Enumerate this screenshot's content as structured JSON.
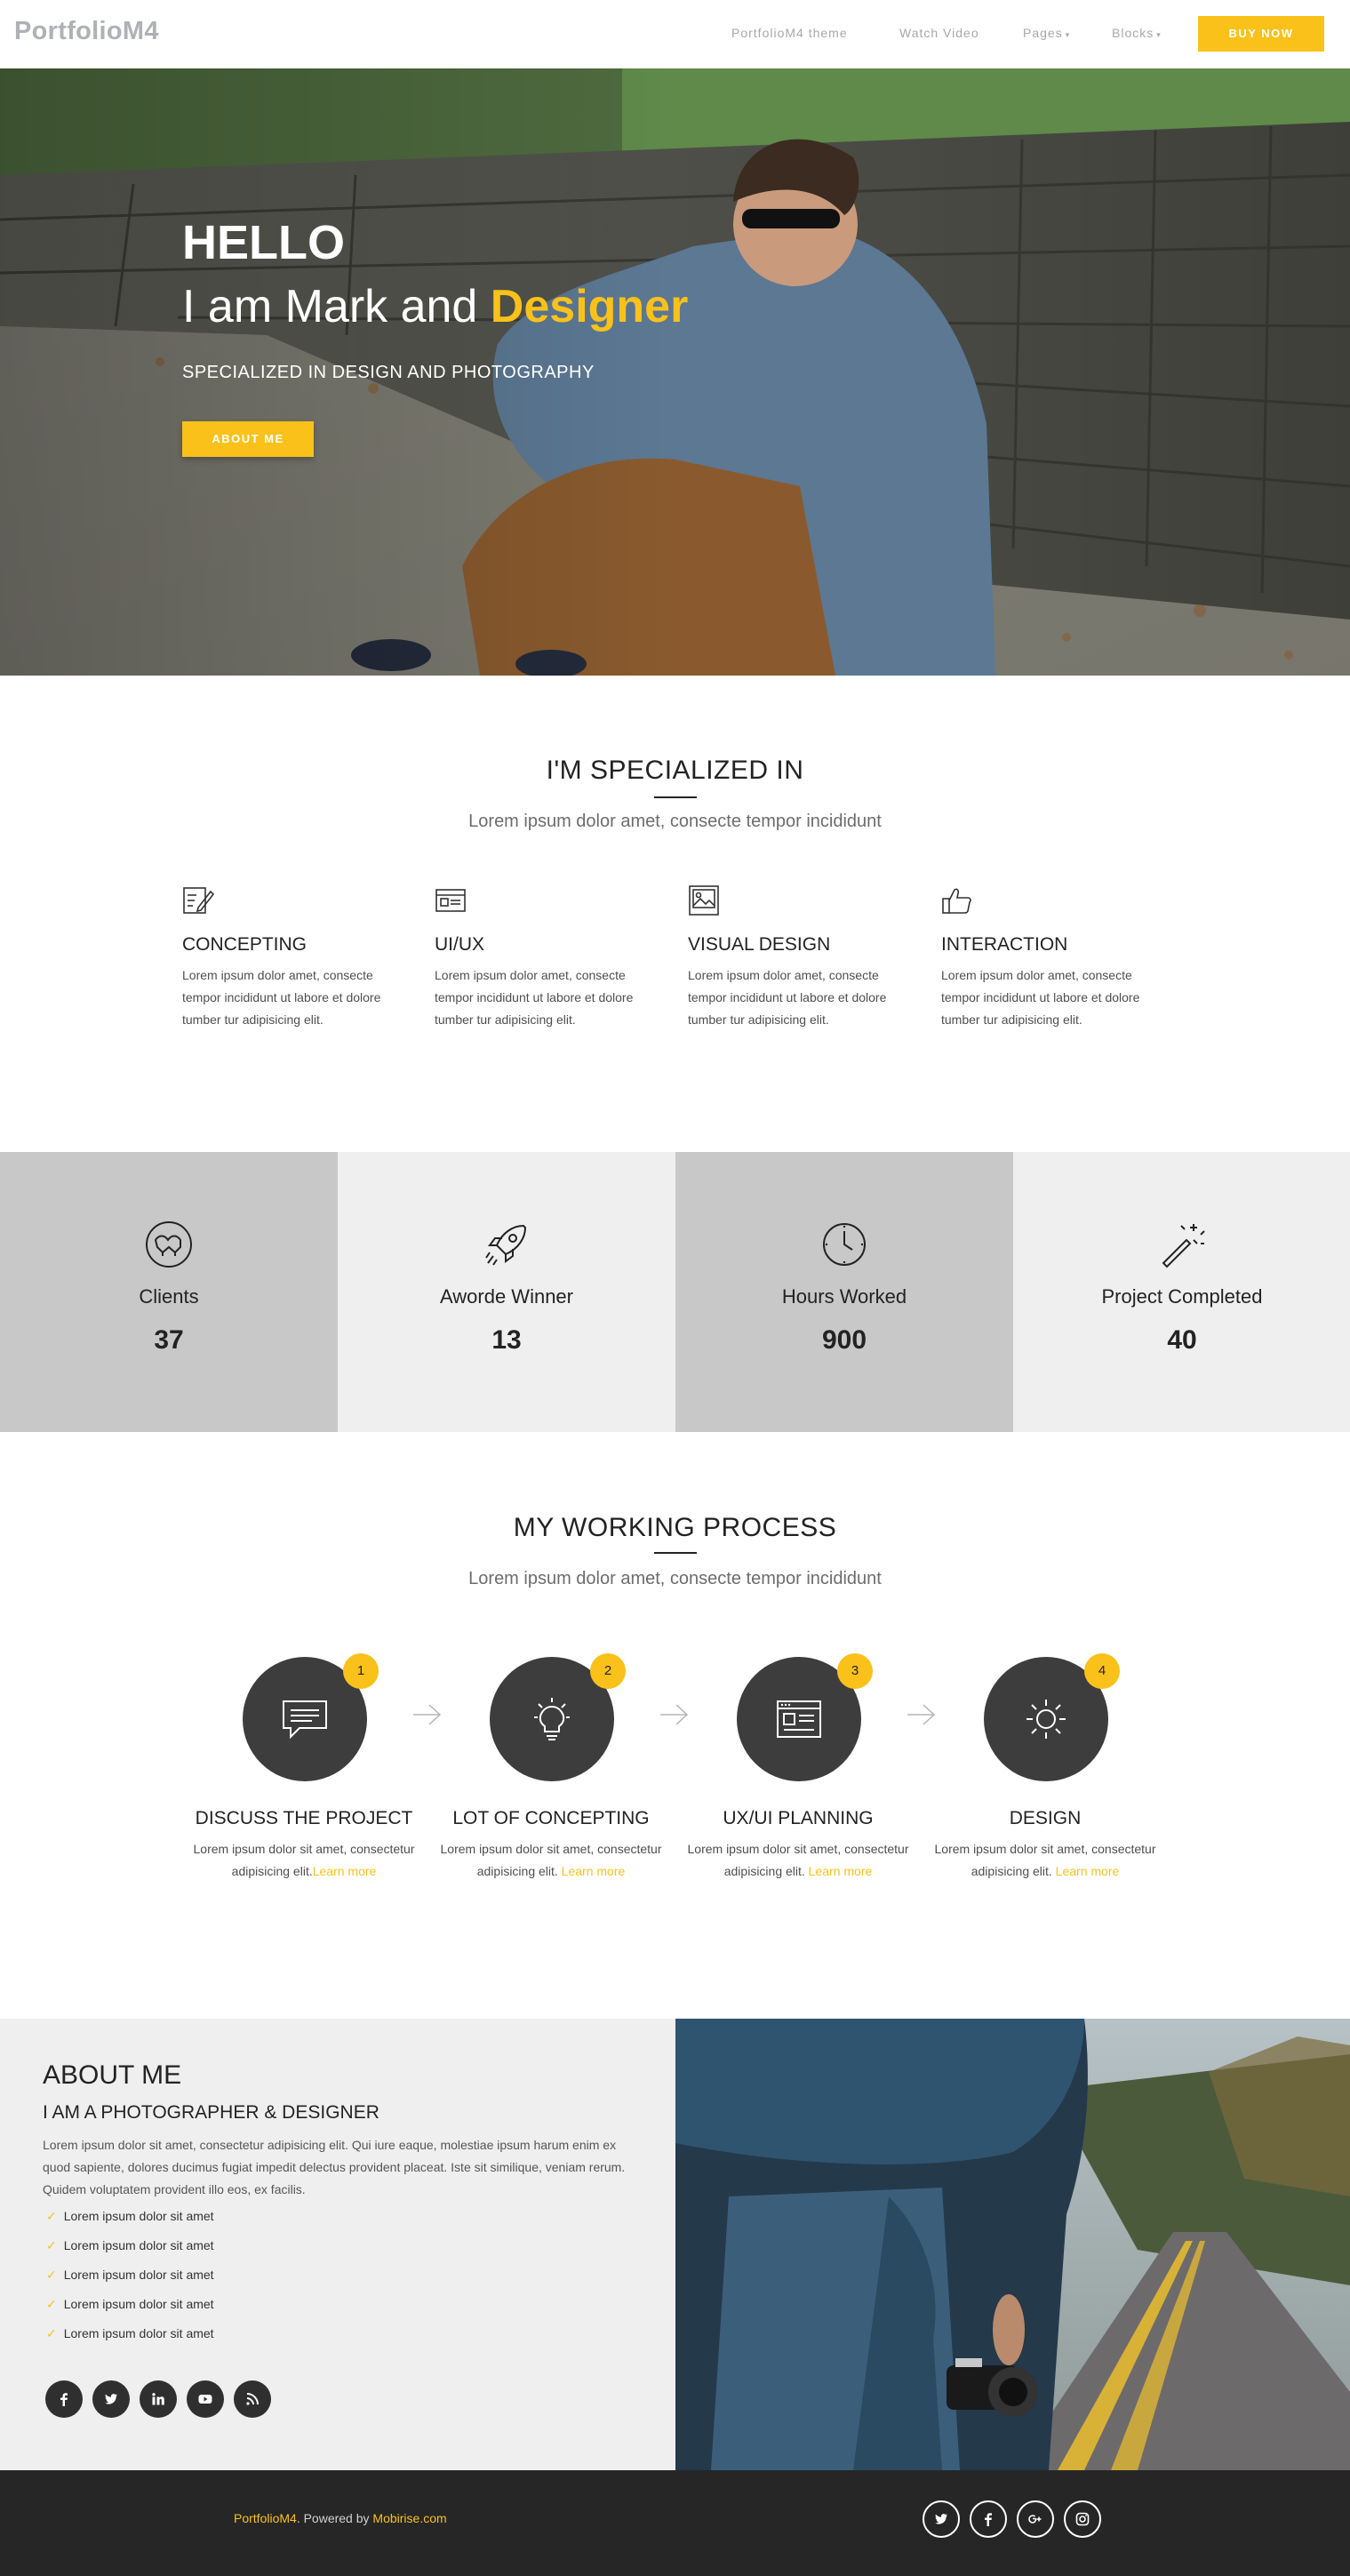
{
  "navbar": {
    "brand": "PortfolioM4",
    "links": [
      "PortfolioM4 theme",
      "Watch Video",
      "Pages",
      "Blocks"
    ],
    "buy_button": "BUY NOW"
  },
  "hero": {
    "hello": "HELLO",
    "iam_prefix": "I am Mark and ",
    "iam_accent": "Designer",
    "subtitle": "SPECIALIZED IN DESIGN AND PHOTOGRAPHY",
    "button": "ABOUT ME"
  },
  "specialized": {
    "title": "I'M SPECIALIZED IN",
    "subtitle": "Lorem ipsum dolor amet, consecte tempor incididunt",
    "items": [
      {
        "title": "CONCEPTING",
        "icon": "edit-note-icon",
        "text": "Lorem ipsum dolor amet, consecte tempor incididunt ut labore et dolore tumber tur adipisicing elit."
      },
      {
        "title": "UI/UX",
        "icon": "browser-window-icon",
        "text": "Lorem ipsum dolor amet, consecte tempor incididunt ut labore et dolore tumber tur adipisicing elit."
      },
      {
        "title": "VISUAL DESIGN",
        "icon": "image-icon",
        "text": "Lorem ipsum dolor amet, consecte tempor incididunt ut labore et dolore tumber tur adipisicing elit."
      },
      {
        "title": "INTERACTION",
        "icon": "thumbs-up-icon",
        "text": "Lorem ipsum dolor amet, consecte tempor incididunt ut labore et dolore tumber tur adipisicing elit."
      }
    ]
  },
  "counters": [
    {
      "label": "Clients",
      "value": "37",
      "icon": "handshake-icon",
      "bg": "#c8c8c8"
    },
    {
      "label": "Aworde Winner",
      "value": "13",
      "icon": "rocket-icon",
      "bg": "#efefef"
    },
    {
      "label": "Hours Worked",
      "value": "900",
      "icon": "clock-icon",
      "bg": "#c8c8c8"
    },
    {
      "label": "Project Completed",
      "value": "40",
      "icon": "magic-wand-icon",
      "bg": "#efefef"
    }
  ],
  "process": {
    "title": "MY WORKING PROCESS",
    "subtitle": "Lorem ipsum dolor amet, consecte tempor incididunt",
    "steps": [
      {
        "number": "1",
        "title": "DISCUSS THE PROJECT",
        "text1": "Lorem ipsum dolor sit amet, consectetur",
        "text2": "adipisicing elit.",
        "more": "Learn more",
        "icon": "chat-bubble-icon"
      },
      {
        "number": "2",
        "title": "LOT OF CONCEPTING",
        "text1": "Lorem ipsum dolor sit amet, consectetur",
        "text2": "adipisicing elit. ",
        "more": "Learn more",
        "icon": "lightbulb-icon"
      },
      {
        "number": "3",
        "title": "UX/UI PLANNING",
        "text1": "Lorem ipsum dolor sit amet, consectetur",
        "text2": "adipisicing elit. ",
        "more": "Learn more",
        "icon": "browser-window-icon"
      },
      {
        "number": "4",
        "title": "DESIGN",
        "text1": "Lorem ipsum dolor sit amet, consectetur",
        "text2": "adipisicing elit. ",
        "more": "Learn more",
        "icon": "sun-icon"
      }
    ]
  },
  "about": {
    "title": "ABOUT ME",
    "subtitle": "I AM A PHOTOGRAPHER & DESIGNER",
    "text": "Lorem ipsum dolor sit amet, consectetur adipisicing elit. Qui iure eaque, molestiae ipsum harum enim ex quod sapiente, dolores ducimus fugiat impedit delectus provident placeat. Iste sit similique, veniam rerum. Quidem voluptatem provident illo eos, ex facilis.",
    "checks": [
      "Lorem ipsum dolor sit amet",
      "Lorem ipsum dolor sit amet",
      "Lorem ipsum dolor sit amet",
      "Lorem ipsum dolor sit amet",
      "Lorem ipsum dolor sit amet"
    ],
    "social": [
      "facebook-icon",
      "twitter-icon",
      "linkedin-icon",
      "youtube-icon",
      "rss-icon"
    ]
  },
  "footer": {
    "brand": "PortfolioM4",
    "powered": ". Powered by ",
    "link": "Mobirise.com",
    "social": [
      "twitter-icon",
      "facebook-icon",
      "google-plus-icon",
      "instagram-icon"
    ]
  },
  "colors": {
    "accent": "#f9c11a",
    "dark": "#3d3d3d",
    "footer": "#262626"
  }
}
